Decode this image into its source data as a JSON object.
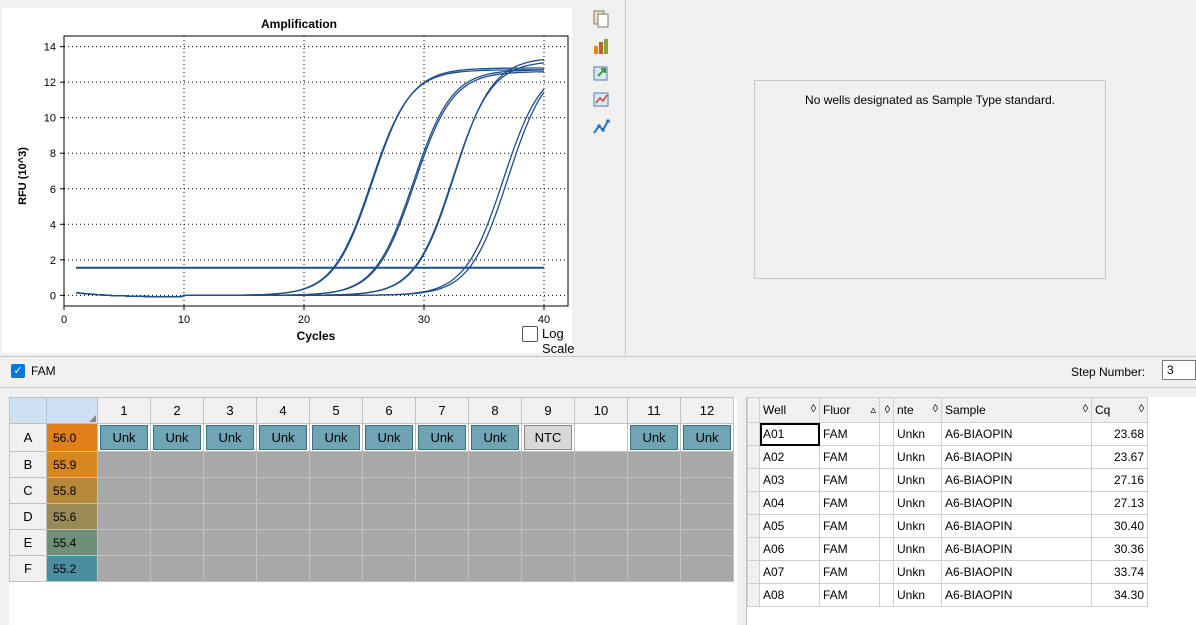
{
  "chart_data": {
    "type": "line",
    "title": "Amplification",
    "xlabel": "Cycles",
    "ylabel": "RFU (10^3)",
    "xlim": [
      0,
      42
    ],
    "ylim": [
      -0.6,
      14.6
    ],
    "xticks": [
      0,
      10,
      20,
      30,
      40
    ],
    "yticks": [
      0,
      2,
      4,
      6,
      8,
      10,
      12,
      14
    ],
    "grid": true,
    "threshold": 1.55,
    "curve_cycle_range": [
      1,
      40
    ],
    "series": [
      {
        "values_midpoint": 25.7,
        "plateau": 12.8
      },
      {
        "values_midpoint": 25.6,
        "plateau": 12.7
      },
      {
        "values_midpoint": 29.2,
        "plateau": 12.6
      },
      {
        "values_midpoint": 29.1,
        "plateau": 12.7
      },
      {
        "values_midpoint": 32.5,
        "plateau": 13.4
      },
      {
        "values_midpoint": 32.4,
        "plateau": 13.2
      },
      {
        "values_midpoint": 36.6,
        "plateau": 13.0
      },
      {
        "values_midpoint": 37.0,
        "plateau": 13.2
      }
    ],
    "line_color": "#1f4e8c",
    "log_scale_label": "Log Scale"
  },
  "toolbar": {
    "icons": [
      "copy-icon",
      "chart-settings-icon",
      "export-icon",
      "zoom-icon",
      "line-style-icon"
    ]
  },
  "standard_curve": {
    "message": "No wells designated as Sample Type standard."
  },
  "fluor_bar": {
    "fluor": "FAM",
    "step_label": "Step Number:",
    "step_value": "3"
  },
  "plate": {
    "columns": [
      "1",
      "2",
      "3",
      "4",
      "5",
      "6",
      "7",
      "8",
      "9",
      "10",
      "11",
      "12"
    ],
    "rows": [
      {
        "label": "A",
        "temp": "56.0",
        "color": "#e07e1a",
        "wells": [
          "Unk",
          "Unk",
          "Unk",
          "Unk",
          "Unk",
          "Unk",
          "Unk",
          "Unk",
          "NTC",
          "",
          "Unk",
          "Unk"
        ]
      },
      {
        "label": "B",
        "temp": "55.9",
        "color": "#d8861f",
        "wells": [
          "",
          "",
          "",
          "",
          "",
          "",
          "",
          "",
          "",
          "",
          "",
          ""
        ]
      },
      {
        "label": "C",
        "temp": "55.8",
        "color": "#b8883a",
        "wells": [
          "",
          "",
          "",
          "",
          "",
          "",
          "",
          "",
          "",
          "",
          "",
          ""
        ]
      },
      {
        "label": "D",
        "temp": "55.6",
        "color": "#9a8a55",
        "wells": [
          "",
          "",
          "",
          "",
          "",
          "",
          "",
          "",
          "",
          "",
          "",
          ""
        ]
      },
      {
        "label": "E",
        "temp": "55.4",
        "color": "#6f8f7a",
        "wells": [
          "",
          "",
          "",
          "",
          "",
          "",
          "",
          "",
          "",
          "",
          "",
          ""
        ]
      },
      {
        "label": "F",
        "temp": "55.2",
        "color": "#4a8ea0",
        "wells": [
          "",
          "",
          "",
          "",
          "",
          "",
          "",
          "",
          "",
          "",
          "",
          ""
        ]
      }
    ]
  },
  "results": {
    "headers": [
      "Well",
      "Fluor",
      "",
      "nte",
      "Sample",
      "Cq"
    ],
    "rows": [
      [
        "A01",
        "FAM",
        "",
        "Unkn",
        "A6-BIAOPIN",
        "23.68"
      ],
      [
        "A02",
        "FAM",
        "",
        "Unkn",
        "A6-BIAOPIN",
        "23.67"
      ],
      [
        "A03",
        "FAM",
        "",
        "Unkn",
        "A6-BIAOPIN",
        "27.16"
      ],
      [
        "A04",
        "FAM",
        "",
        "Unkn",
        "A6-BIAOPIN",
        "27.13"
      ],
      [
        "A05",
        "FAM",
        "",
        "Unkn",
        "A6-BIAOPIN",
        "30.40"
      ],
      [
        "A06",
        "FAM",
        "",
        "Unkn",
        "A6-BIAOPIN",
        "30.36"
      ],
      [
        "A07",
        "FAM",
        "",
        "Unkn",
        "A6-BIAOPIN",
        "33.74"
      ],
      [
        "A08",
        "FAM",
        "",
        "Unkn",
        "A6-BIAOPIN",
        "34.30"
      ]
    ]
  }
}
